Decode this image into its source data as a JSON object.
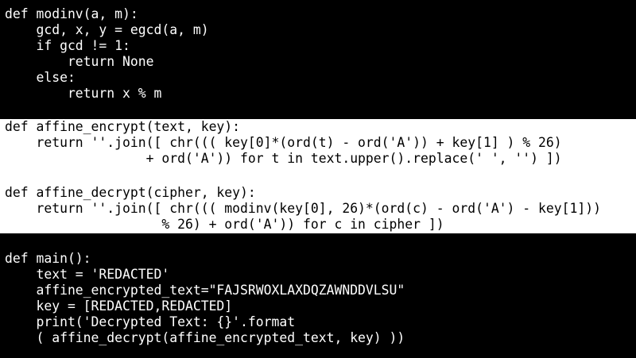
{
  "editor": {
    "block_modinv": {
      "lines": [
        "def modinv(a, m):",
        "    gcd, x, y = egcd(a, m)",
        "    if gcd != 1:",
        "        return None",
        "    else:",
        "        return x % m"
      ]
    },
    "block_affine": {
      "highlight_color": "#ffffff",
      "lines": [
        "def affine_encrypt(text, key):",
        "    return ''.join([ chr((( key[0]*(ord(t) - ord('A')) + key[1] ) % 26)",
        "                  + ord('A')) for t in text.upper().replace(' ', '') ])",
        "",
        "def affine_decrypt(cipher, key):",
        "    return ''.join([ chr((( modinv(key[0], 26)*(ord(c) - ord('A') - key[1]))",
        "                    % 26) + ord('A')) for c in cipher ])"
      ]
    },
    "block_main": {
      "lines": [
        "def main():",
        "    text = 'REDACTED'",
        "    affine_encrypted_text=\"FAJSRWOXLAXDQZAWNDDVLSU\"",
        "    key = [REDACTED,REDACTED]",
        "    print('Decrypted Text: {}'.format",
        "    ( affine_decrypt(affine_encrypted_text, key) ))"
      ]
    }
  }
}
